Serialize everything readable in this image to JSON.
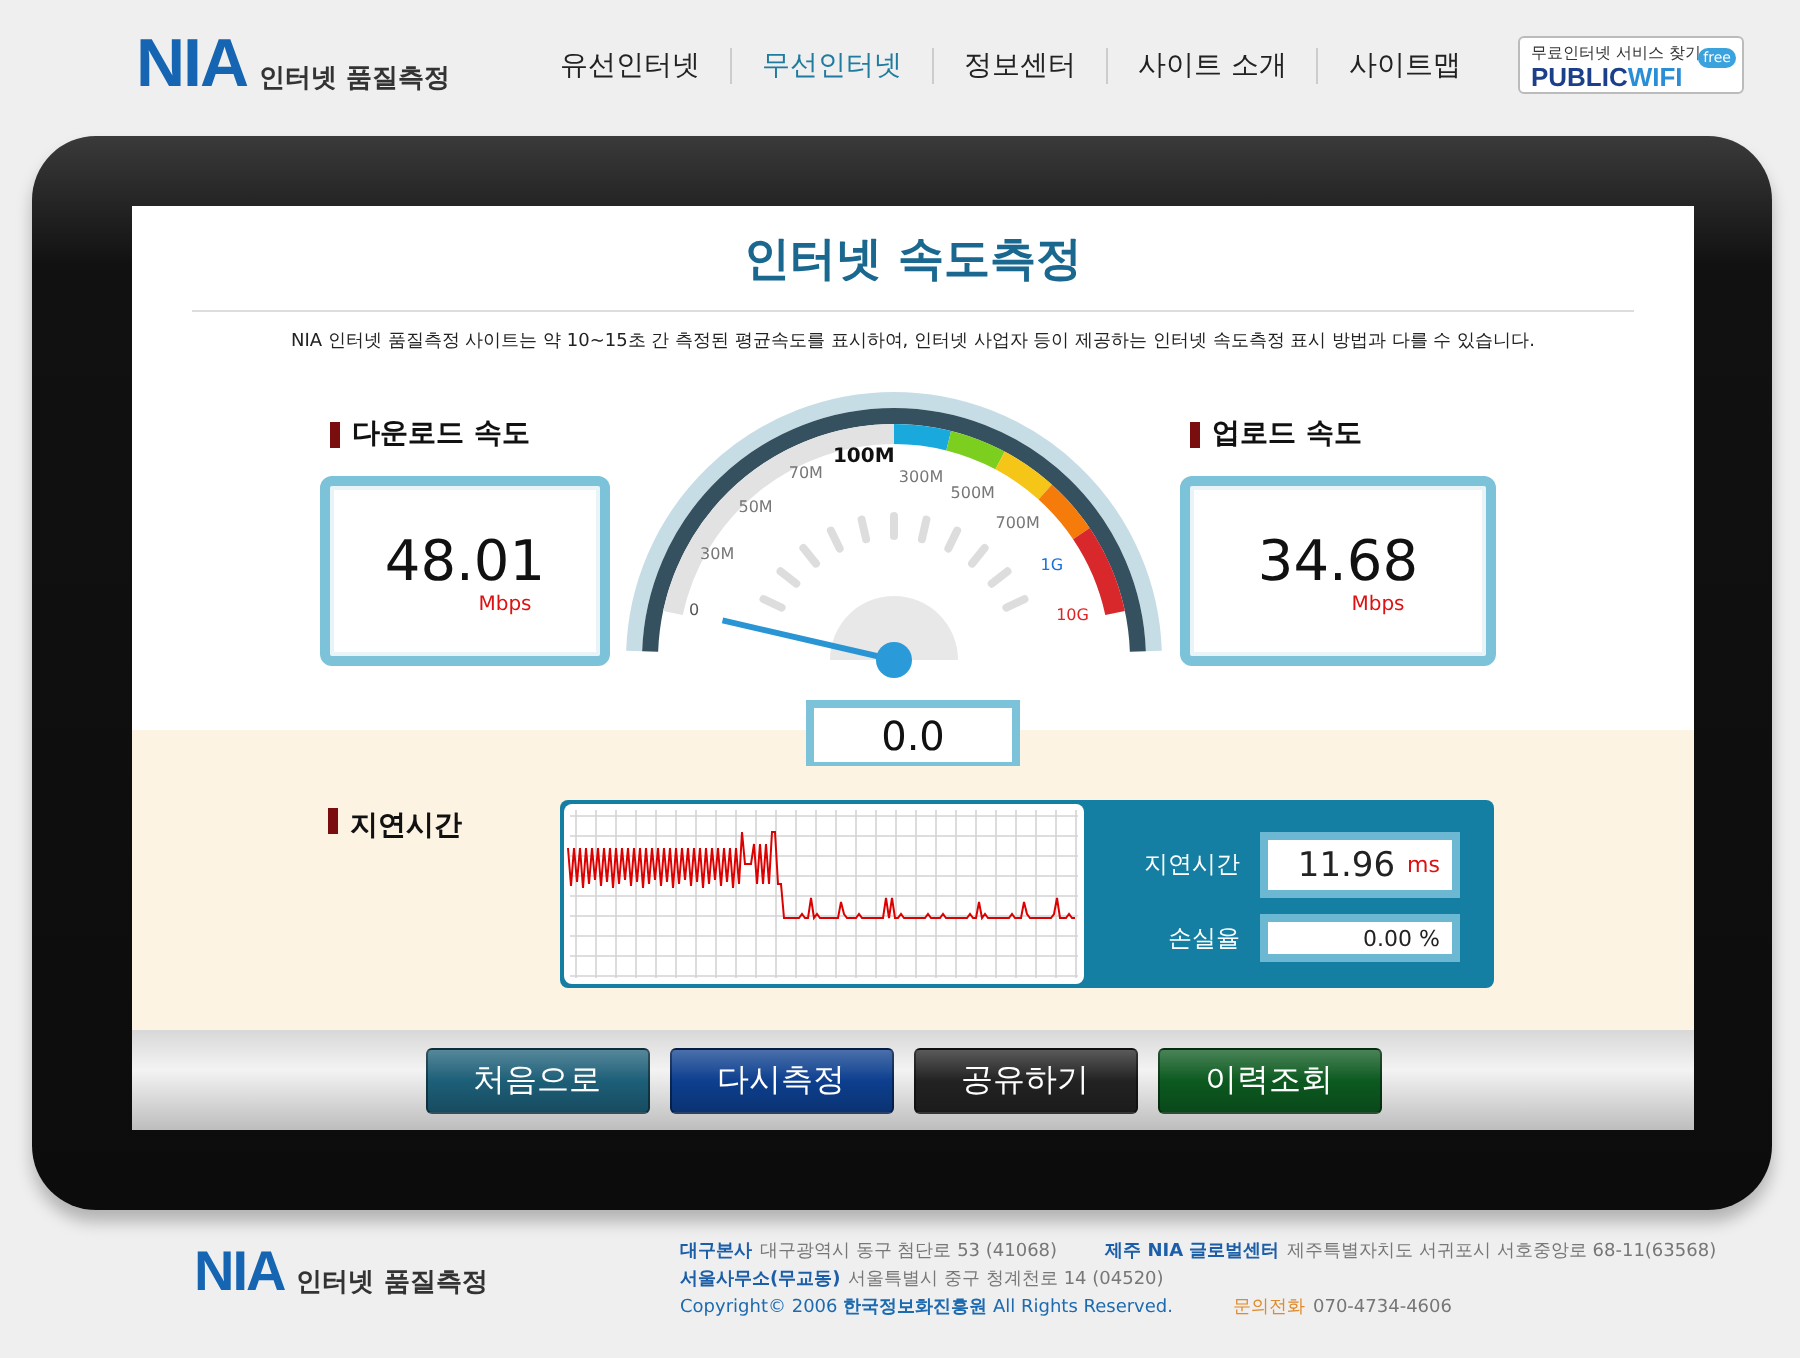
{
  "header": {
    "logo": {
      "mark": "NIA",
      "name": "인터넷 품질측정"
    },
    "nav": [
      {
        "label": "유선인터넷",
        "selected": false
      },
      {
        "label": "무선인터넷",
        "selected": true
      },
      {
        "label": "정보센터",
        "selected": false
      },
      {
        "label": "사이트 소개",
        "selected": false
      },
      {
        "label": "사이트맵",
        "selected": false
      }
    ],
    "wifi_badge": {
      "caption": "무료인터넷 서비스 찾기",
      "brand_a": "PUBLIC",
      "brand_b": "WIFI",
      "tag": "free"
    }
  },
  "screen": {
    "title": "인터넷 속도측정",
    "description": "NIA 인터넷 품질측정 사이트는 약 10~15초 간 측정된 평균속도를 표시하여, 인터넷 사업자 등이 제공하는 인터넷 속도측정 표시 방법과 다를 수 있습니다.",
    "download": {
      "label": "다운로드 속도",
      "value": "48.01",
      "unit": "Mbps"
    },
    "upload": {
      "label": "업로드 속도",
      "value": "34.68",
      "unit": "Mbps"
    },
    "gauge": {
      "scale": [
        {
          "label": "0",
          "color": "#555555"
        },
        {
          "label": "30M",
          "color": "#777777"
        },
        {
          "label": "50M",
          "color": "#777777"
        },
        {
          "label": "70M",
          "color": "#777777"
        },
        {
          "label": "100M",
          "color": "#111111"
        },
        {
          "label": "300M",
          "color": "#777777"
        },
        {
          "label": "500M",
          "color": "#777777"
        },
        {
          "label": "700M",
          "color": "#777777"
        },
        {
          "label": "1G",
          "color": "#1a6fe0"
        },
        {
          "label": "10G",
          "color": "#e02424"
        }
      ],
      "reading": "0.0"
    },
    "latency": {
      "label": "지연시간",
      "metrics": [
        {
          "label": "지연시간",
          "value": "11.96",
          "unit": "ms"
        },
        {
          "label": "손실율",
          "value": "0.00 %"
        }
      ]
    },
    "buttons": [
      {
        "label": "처음으로",
        "color": "#1d5f78"
      },
      {
        "label": "다시측정",
        "color": "#0d3f8f"
      },
      {
        "label": "공유하기",
        "color": "#222222"
      },
      {
        "label": "이력조회",
        "color": "#0c5a20"
      }
    ]
  },
  "footer": {
    "logo": {
      "mark": "NIA",
      "name": "인터넷 품질측정"
    },
    "lines": [
      [
        {
          "text": "대구본사",
          "kind": "label"
        },
        {
          "text": "대구광역시 동구 첨단로 53 (41068)",
          "kind": "text"
        },
        {
          "text": "제주 NIA 글로벌센터",
          "kind": "label"
        },
        {
          "text": "제주특별자치도 서귀포시 서호중앙로 68-11(63568)",
          "kind": "text"
        }
      ],
      [
        {
          "text": "서울사무소(무교동)",
          "kind": "label"
        },
        {
          "text": "서울특별시 중구 청계천로 14 (04520)",
          "kind": "text"
        }
      ],
      [
        {
          "text": "Copyright© 2006 **한국정보화진흥원** All Rights Reserved.",
          "kind": "copyright"
        },
        {
          "text": "문의전화",
          "kind": "contact"
        },
        {
          "text": "070-4734-4606",
          "kind": "text"
        }
      ]
    ]
  }
}
